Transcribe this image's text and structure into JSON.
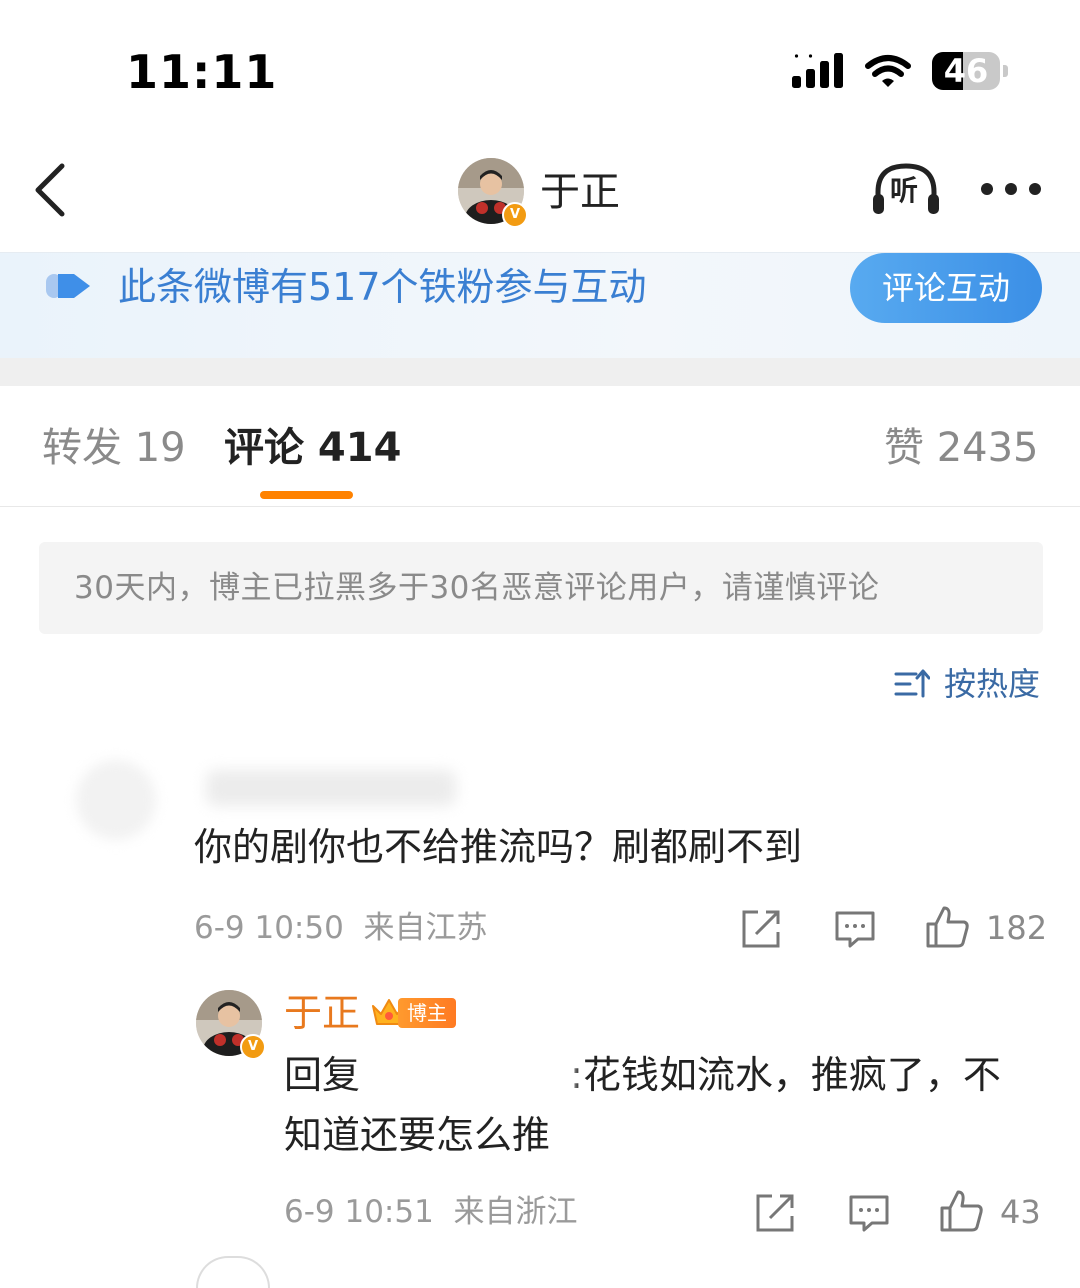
{
  "status_bar": {
    "time": "11:11",
    "battery": "46"
  },
  "header": {
    "title": "于正",
    "listen_label": "听"
  },
  "banner": {
    "text": "此条微博有517个铁粉参与互动",
    "button": "评论互动"
  },
  "tabs": [
    {
      "label": "转发 19"
    },
    {
      "label": "评论 414"
    },
    {
      "label": "赞 2435"
    }
  ],
  "notice": "30天内，博主已拉黑多于30名恶意评论用户，请谨慎评论",
  "sort": {
    "label": "按热度"
  },
  "comment": {
    "text": "你的剧你也不给推流吗？刷都刷不到",
    "time": "6-9 10:50",
    "location": "来自江苏",
    "likes": "182"
  },
  "reply": {
    "name": "于正",
    "badge": "博主",
    "prefix": "回复",
    "text_line1": ":花钱如流水，推疯了，不",
    "text_line2": "知道还要怎么推",
    "time": "6-9 10:51",
    "location": "来自浙江",
    "likes": "43"
  },
  "colors": {
    "accent": "#ff8200",
    "link_blue": "#3a7fd2",
    "name_orange": "#e8791e"
  }
}
